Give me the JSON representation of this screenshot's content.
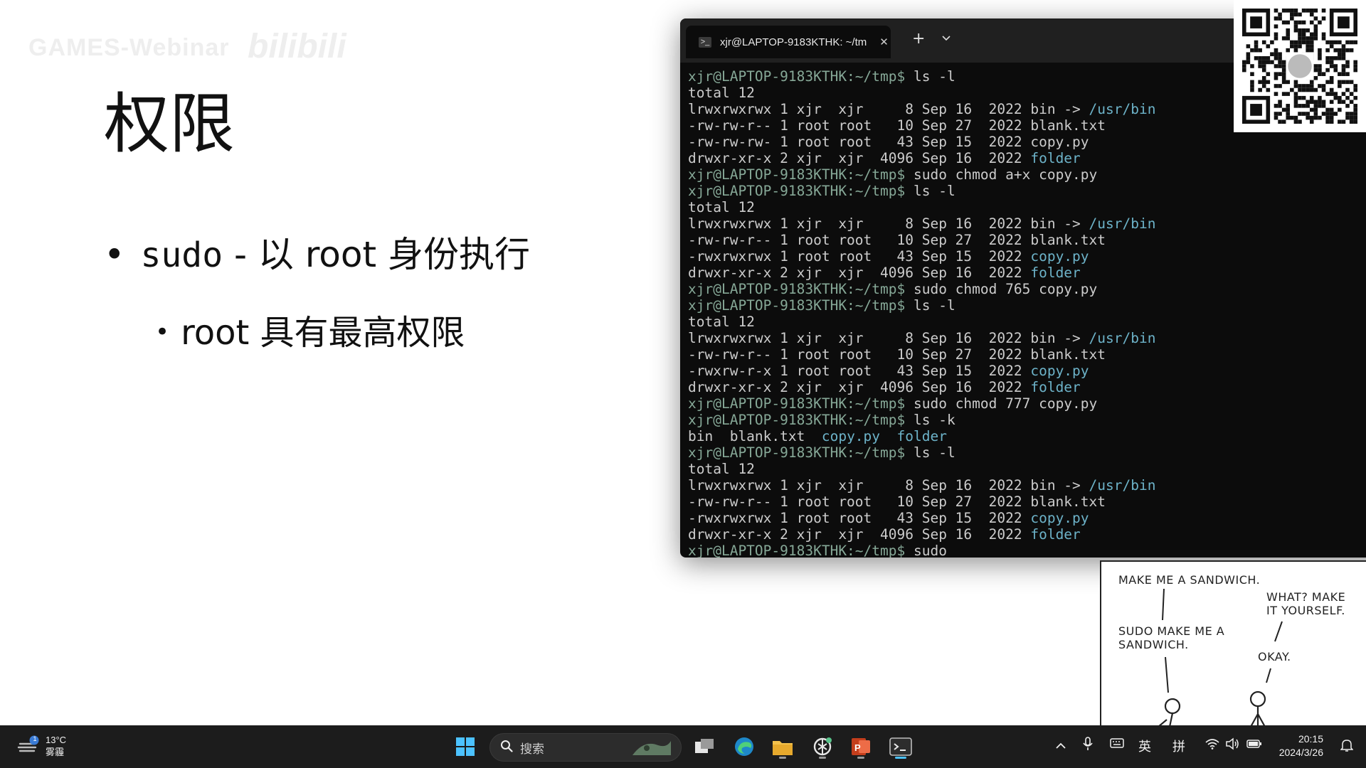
{
  "slide": {
    "watermark": "GAMES-Webinar",
    "watermark_logo": "bilibili",
    "title": "权限",
    "bullet1": {
      "code": "sudo",
      "text": " - 以 root 身份执行"
    },
    "bullet2": {
      "text": "root 具有最高权限"
    }
  },
  "terminal": {
    "tab_title": "xjr@LAPTOP-9183KTHK: ~/tm",
    "tab_icon": "terminal-icon",
    "prompt": "xjr@LAPTOP-9183KTHK:~/tmp$",
    "lines": [
      {
        "kind": "cmd",
        "text": " ls -l"
      },
      {
        "kind": "out",
        "text": "total 12"
      },
      {
        "kind": "ls",
        "pre": "lrwxrwxrwx 1 xjr  xjr     8 Sep 16  2022 bin -> ",
        "hl": "/usr/bin"
      },
      {
        "kind": "out",
        "text": "-rw-rw-r-- 1 root root   10 Sep 27  2022 blank.txt"
      },
      {
        "kind": "out",
        "text": "-rw-rw-rw- 1 root root   43 Sep 15  2022 copy.py"
      },
      {
        "kind": "ls",
        "pre": "drwxr-xr-x 2 xjr  xjr  4096 Sep 16  2022 ",
        "hl": "folder"
      },
      {
        "kind": "cmd",
        "text": " sudo chmod a+x copy.py"
      },
      {
        "kind": "cmd",
        "text": " ls -l"
      },
      {
        "kind": "out",
        "text": "total 12"
      },
      {
        "kind": "ls",
        "pre": "lrwxrwxrwx 1 xjr  xjr     8 Sep 16  2022 bin -> ",
        "hl": "/usr/bin"
      },
      {
        "kind": "out",
        "text": "-rw-rw-r-- 1 root root   10 Sep 27  2022 blank.txt"
      },
      {
        "kind": "ls",
        "pre": "-rwxrwxrwx 1 root root   43 Sep 15  2022 ",
        "hl": "copy.py"
      },
      {
        "kind": "ls",
        "pre": "drwxr-xr-x 2 xjr  xjr  4096 Sep 16  2022 ",
        "hl": "folder"
      },
      {
        "kind": "cmd",
        "text": " sudo chmod 765 copy.py"
      },
      {
        "kind": "cmd",
        "text": " ls -l"
      },
      {
        "kind": "out",
        "text": "total 12"
      },
      {
        "kind": "ls",
        "pre": "lrwxrwxrwx 1 xjr  xjr     8 Sep 16  2022 bin -> ",
        "hl": "/usr/bin"
      },
      {
        "kind": "out",
        "text": "-rw-rw-r-- 1 root root   10 Sep 27  2022 blank.txt"
      },
      {
        "kind": "ls",
        "pre": "-rwxrw-r-x 1 root root   43 Sep 15  2022 ",
        "hl": "copy.py"
      },
      {
        "kind": "ls",
        "pre": "drwxr-xr-x 2 xjr  xjr  4096 Sep 16  2022 ",
        "hl": "folder"
      },
      {
        "kind": "cmd",
        "text": " sudo chmod 777 copy.py"
      },
      {
        "kind": "cmd",
        "text": " ls -k"
      },
      {
        "kind": "lsk",
        "parts": [
          {
            "t": "bin  blank.txt  ",
            "h": false
          },
          {
            "t": "copy.py",
            "h": true
          },
          {
            "t": "  ",
            "h": false
          },
          {
            "t": "folder",
            "h": true
          }
        ]
      },
      {
        "kind": "cmd",
        "text": " ls -l"
      },
      {
        "kind": "out",
        "text": "total 12"
      },
      {
        "kind": "ls",
        "pre": "lrwxrwxrwx 1 xjr  xjr     8 Sep 16  2022 bin -> ",
        "hl": "/usr/bin"
      },
      {
        "kind": "out",
        "text": "-rw-rw-r-- 1 root root   10 Sep 27  2022 blank.txt"
      },
      {
        "kind": "ls",
        "pre": "-rwxrwxrwx 1 root root   43 Sep 15  2022 ",
        "hl": "copy.py"
      },
      {
        "kind": "ls",
        "pre": "drwxr-xr-x 2 xjr  xjr  4096 Sep 16  2022 ",
        "hl": "folder"
      },
      {
        "kind": "cmd",
        "text": " sudo"
      }
    ],
    "colors": {
      "prompt": "#86a897",
      "highlight": "#6db3c9",
      "text": "#cccccc",
      "background": "#0c0c0c"
    }
  },
  "comic": {
    "speech1": "Make me a sandwich.",
    "speech2": "What? Make it yourself.",
    "speech3": "Sudo make me a sandwich.",
    "speech4": "Okay."
  },
  "taskbar": {
    "weather_temp": "13°C",
    "weather_desc": "雾霾",
    "weather_badge": "1",
    "search_placeholder": "搜索",
    "tray_lang1": "英",
    "tray_lang2": "拼",
    "time": "20:15",
    "date": "2024/3/26"
  }
}
